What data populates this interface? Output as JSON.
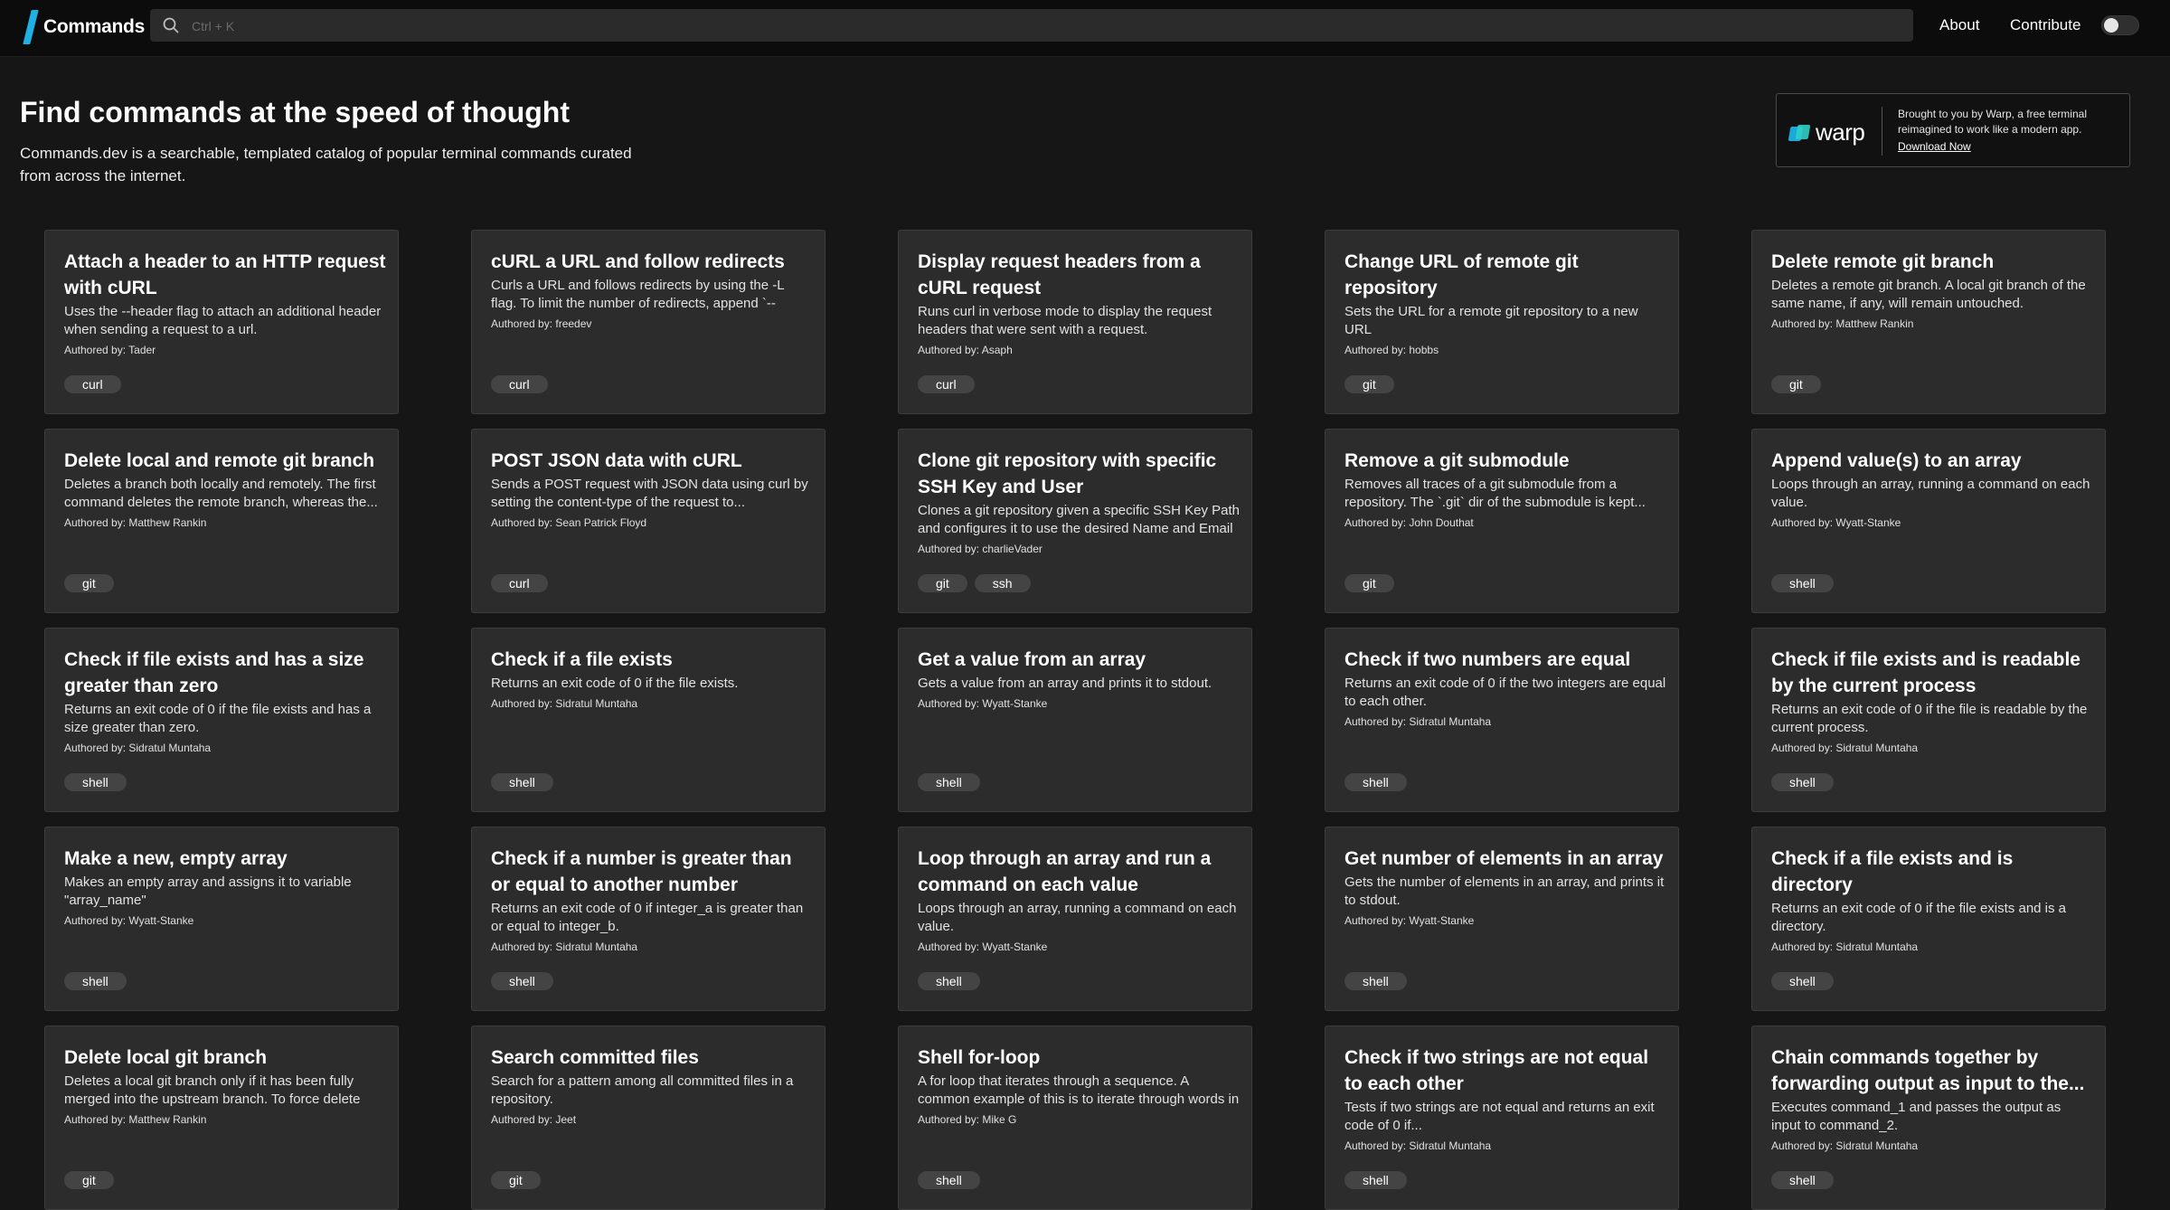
{
  "nav": {
    "logo_text": "Commands",
    "search_placeholder": "Ctrl + K",
    "about_label": "About",
    "contribute_label": "Contribute"
  },
  "hero": {
    "title": "Find commands at the speed of thought",
    "description": "Commands.dev is a searchable, templated catalog of popular terminal commands curated from across the internet."
  },
  "promo": {
    "logo_text": "warp",
    "text": "Brought to you by Warp, a free terminal reimagined to work like a modern app.",
    "link_label": "Download Now"
  },
  "colors": {
    "background": "#161616",
    "card": "#2c2c2c",
    "tag": "#444444",
    "accent": "#1fb1e3"
  },
  "cards": [
    {
      "title": "Attach a header to an HTTP request with cURL",
      "description": "Uses the --header flag to attach an additional header when sending a request to a url.",
      "author": "Authored by: Tader",
      "tags": [
        "curl"
      ]
    },
    {
      "title": "cURL a URL and follow redirects",
      "description": "Curls a URL and follows redirects by using the -L flag. To limit the number of redirects, append `--max-...",
      "author": "Authored by: freedev",
      "tags": [
        "curl"
      ]
    },
    {
      "title": "Display request headers from a cURL request",
      "description": "Runs curl in verbose mode to display the request headers that were sent with a request.",
      "author": "Authored by: Asaph",
      "tags": [
        "curl"
      ]
    },
    {
      "title": "Change URL of remote git repository",
      "description": "Sets the URL for a remote git repository to a new URL",
      "author": "Authored by: hobbs",
      "tags": [
        "git"
      ]
    },
    {
      "title": "Delete remote git branch",
      "description": "Deletes a remote git branch. A local git branch of the same name, if any, will remain untouched.",
      "author": "Authored by: Matthew Rankin",
      "tags": [
        "git"
      ]
    },
    {
      "title": "Delete local and remote git branch",
      "description": "Deletes a branch both locally and remotely. The first command deletes the remote branch, whereas the...",
      "author": "Authored by: Matthew Rankin",
      "tags": [
        "git"
      ]
    },
    {
      "title": "POST JSON data with cURL",
      "description": "Sends a POST request with JSON data using curl by setting the content-type of the request to...",
      "author": "Authored by: Sean Patrick Floyd",
      "tags": [
        "curl"
      ]
    },
    {
      "title": "Clone git repository with specific SSH Key and User",
      "description": "Clones a git repository given a specific SSH Key Path and configures it to use the desired Name and Email",
      "author": "Authored by: charlieVader",
      "tags": [
        "git",
        "ssh"
      ]
    },
    {
      "title": "Remove a git submodule",
      "description": "Removes all traces of a git submodule from a repository. The `.git` dir of the submodule is kept...",
      "author": "Authored by: John Douthat",
      "tags": [
        "git"
      ]
    },
    {
      "title": "Append value(s) to an array",
      "description": "Loops through an array, running a command on each value.",
      "author": "Authored by: Wyatt-Stanke",
      "tags": [
        "shell"
      ]
    },
    {
      "title": "Check if file exists and has a size greater than zero",
      "description": "Returns an exit code of 0 if the file exists and has a size greater than zero.",
      "author": "Authored by: Sidratul Muntaha",
      "tags": [
        "shell"
      ]
    },
    {
      "title": "Check if a file exists",
      "description": "Returns an exit code of 0 if the file exists.",
      "author": "Authored by: Sidratul Muntaha",
      "tags": [
        "shell"
      ]
    },
    {
      "title": "Get a value from an array",
      "description": "Gets a value from an array and prints it to stdout.",
      "author": "Authored by: Wyatt-Stanke",
      "tags": [
        "shell"
      ]
    },
    {
      "title": "Check if two numbers are equal",
      "description": "Returns an exit code of 0 if the two integers are equal to each other.",
      "author": "Authored by: Sidratul Muntaha",
      "tags": [
        "shell"
      ]
    },
    {
      "title": "Check if file exists and is readable by the current process",
      "description": "Returns an exit code of 0 if the file is readable by the current process.",
      "author": "Authored by: Sidratul Muntaha",
      "tags": [
        "shell"
      ]
    },
    {
      "title": "Make a new, empty array",
      "description": "Makes an empty array and assigns it to variable \"array_name\"",
      "author": "Authored by: Wyatt-Stanke",
      "tags": [
        "shell"
      ]
    },
    {
      "title": "Check if a number is greater than or equal to another number",
      "description": "Returns an exit code of 0 if integer_a is greater than or equal to integer_b.",
      "author": "Authored by: Sidratul Muntaha",
      "tags": [
        "shell"
      ]
    },
    {
      "title": "Loop through an array and run a command on each value",
      "description": "Loops through an array, running a command on each value.",
      "author": "Authored by: Wyatt-Stanke",
      "tags": [
        "shell"
      ]
    },
    {
      "title": "Get number of elements in an array",
      "description": "Gets the number of elements in an array, and prints it to stdout.",
      "author": "Authored by: Wyatt-Stanke",
      "tags": [
        "shell"
      ]
    },
    {
      "title": "Check if a file exists and is directory",
      "description": "Returns an exit code of 0 if the file exists and is a directory.",
      "author": "Authored by: Sidratul Muntaha",
      "tags": [
        "shell"
      ]
    },
    {
      "title": "Delete local git branch",
      "description": "Deletes a local git branch only if it has been fully merged into the upstream branch. To force delete the...",
      "author": "Authored by: Matthew Rankin",
      "tags": [
        "git"
      ]
    },
    {
      "title": "Search committed files",
      "description": "Search for a pattern among all committed files in a repository.",
      "author": "Authored by: Jeet",
      "tags": [
        "git"
      ]
    },
    {
      "title": "Shell for-loop",
      "description": "A for loop that iterates through a sequence. A common example of this is to iterate through words in in a...",
      "author": "Authored by: Mike G",
      "tags": [
        "shell"
      ]
    },
    {
      "title": "Check if two strings are not equal to each other",
      "description": "Tests if two strings are not equal and returns an exit code of 0 if...",
      "author": "Authored by: Sidratul Muntaha",
      "tags": [
        "shell"
      ]
    },
    {
      "title": "Chain commands together by forwarding output as input to the...",
      "description": "Executes command_1 and passes the output as input to command_2.",
      "author": "Authored by: Sidratul Muntaha",
      "tags": [
        "shell"
      ]
    }
  ]
}
